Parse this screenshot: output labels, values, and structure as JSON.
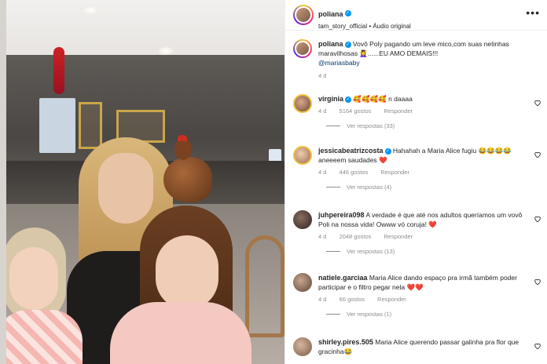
{
  "header": {
    "username": "poliana",
    "verified_icon": "verified-badge-icon",
    "audio_line": "tam_story_official • Áudio original",
    "more_icon": "more-options-icon"
  },
  "caption": {
    "username": "poliana",
    "text": "Vovô Poly pagando um leve mico,com suas netinhas maravilhosas 💆‍♀️......EU AMO DEMAIS!!!",
    "mention": "@mariasbaby",
    "time": "4 d"
  },
  "comments": [
    {
      "username": "virginia",
      "verified": true,
      "text": "🥰🥰🥰🥰 n daaaa",
      "time": "4 d",
      "likes": "5164 gostos",
      "reply_label": "Responder",
      "replies": "Ver respostas (33)"
    },
    {
      "username": "jessicabeatrizcosta",
      "verified": true,
      "text": "Hahahah a Maria Alice fugiu 😂😂😂😂 aneeeem saudades ❤️",
      "time": "4 d",
      "likes": "446 gostos",
      "reply_label": "Responder",
      "replies": "Ver respostas (4)"
    },
    {
      "username": "juhpereira098",
      "verified": false,
      "text": "A verdade é que até nos adultos queríamos um vovô Poli na nossa vida! Owww vó coruja! ❤️",
      "time": "4 d",
      "likes": "2048 gostos",
      "reply_label": "Responder",
      "replies": "Ver respostas (13)"
    },
    {
      "username": "natiele.garciaa",
      "verified": false,
      "text": "Maria Alice dando espaço pra irmã também poder participar e o filtro pegar nela ❤️❤️",
      "time": "4 d",
      "likes": "66 gostos",
      "reply_label": "Responder",
      "replies": "Ver respostas (1)"
    },
    {
      "username": "shirley.pires.505",
      "verified": false,
      "text": "Maria Alice querendo passar galinha pra flor que gracinha😂",
      "time": "",
      "likes": "",
      "reply_label": "",
      "replies": ""
    }
  ],
  "icons": {
    "heart": "heart-outline-icon"
  },
  "colors": {
    "verified_blue": "#0095f6",
    "meta_gray": "#8e8e8e",
    "mention_blue": "#00376b",
    "text": "#262626"
  }
}
